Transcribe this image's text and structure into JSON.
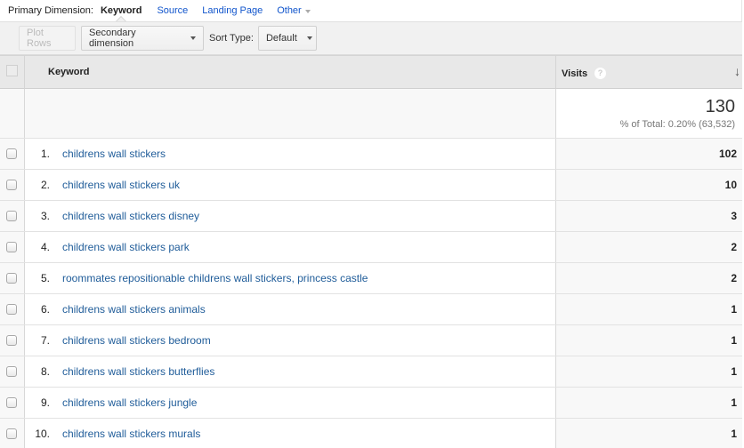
{
  "primary_dimension": {
    "label": "Primary Dimension:",
    "current": "Keyword",
    "options": [
      "Source",
      "Landing Page"
    ],
    "other_label": "Other"
  },
  "toolbar": {
    "plot_rows_label": "Plot Rows",
    "secondary_dimension_label": "Secondary dimension",
    "sort_type_label": "Sort Type:",
    "sort_type_value": "Default"
  },
  "table": {
    "columns": {
      "keyword": "Keyword",
      "visits": "Visits",
      "help_icon_glyph": "?",
      "sort_arrow_glyph": "↓"
    },
    "totals": {
      "visits": "130",
      "percent_of_total": "% of Total: 0.20% (63,532)"
    },
    "rows": [
      {
        "index": "1.",
        "keyword": "childrens wall stickers",
        "visits": "102"
      },
      {
        "index": "2.",
        "keyword": "childrens wall stickers uk",
        "visits": "10"
      },
      {
        "index": "3.",
        "keyword": "childrens wall stickers disney",
        "visits": "3"
      },
      {
        "index": "4.",
        "keyword": "childrens wall stickers park",
        "visits": "2"
      },
      {
        "index": "5.",
        "keyword": "roommates repositionable childrens wall stickers, princess castle",
        "visits": "2"
      },
      {
        "index": "6.",
        "keyword": "childrens wall stickers animals",
        "visits": "1"
      },
      {
        "index": "7.",
        "keyword": "childrens wall stickers bedroom",
        "visits": "1"
      },
      {
        "index": "8.",
        "keyword": "childrens wall stickers butterflies",
        "visits": "1"
      },
      {
        "index": "9.",
        "keyword": "childrens wall stickers jungle",
        "visits": "1"
      },
      {
        "index": "10.",
        "keyword": "childrens wall stickers murals",
        "visits": "1"
      }
    ]
  },
  "colors": {
    "link": "#1155cc",
    "keyword_link": "#1f5c99",
    "header_bg": "#e8e8e8",
    "toolbar_bg": "#f1f1f1"
  }
}
